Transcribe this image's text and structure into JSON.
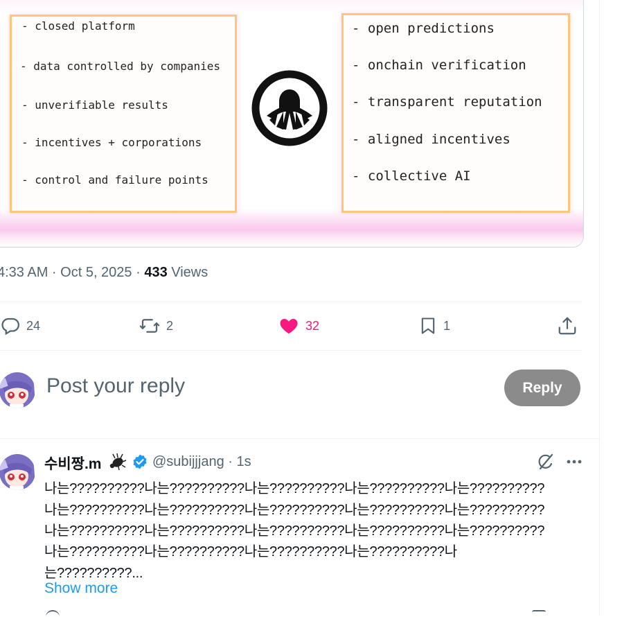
{
  "media": {
    "left_items": [
      "- closed platform",
      "- data controlled by companies",
      "- unverifiable results",
      "- incentives + corporations",
      "- control and failure points"
    ],
    "right_items": [
      "- open predictions",
      "- onchain verification",
      "- transparent reputation",
      "- aligned incentives",
      "- collective AI"
    ],
    "logo_icon": "palm-logo-icon"
  },
  "meta": {
    "time": "4:33 AM · Oct 5, 2025 · ",
    "views_count": "433",
    "views_label": " Views"
  },
  "actions": {
    "replies": "24",
    "reposts": "2",
    "likes": "32",
    "bookmarks": "1",
    "like_color": "#f91880"
  },
  "composer": {
    "placeholder": "Post your reply",
    "button": "Reply"
  },
  "reply": {
    "name": "수비짱.m",
    "handle_time": "@subijjjang · 1s",
    "lines": [
      "나는??????????나는??????????나는??????????나는??????????나는??????????",
      "나는??????????나는??????????나는??????????나는??????????나는??????????",
      "나는??????????나는??????????나는??????????나는??????????나는??????????",
      "나는??????????나는??????????나는??????????나는??????????나",
      "는??????????..."
    ],
    "show_more": "Show more"
  }
}
